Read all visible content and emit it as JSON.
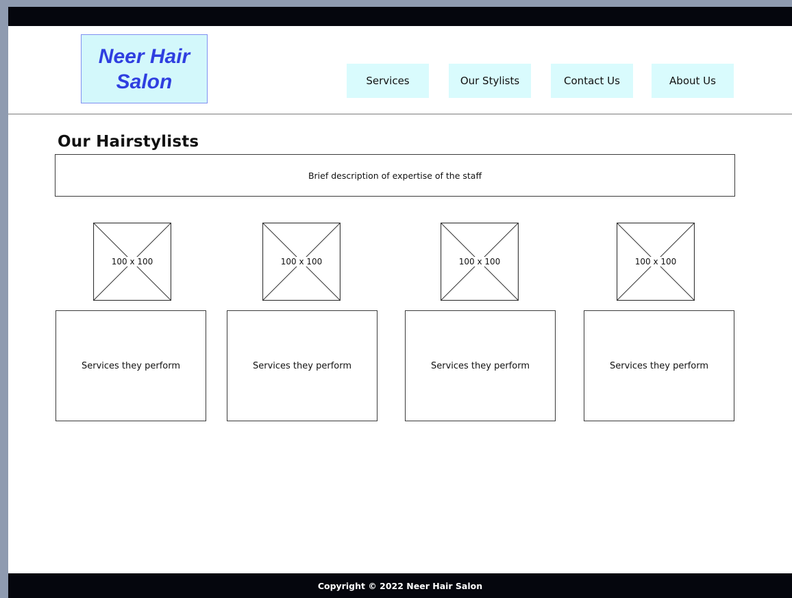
{
  "header": {
    "logo_text": "Neer Hair Salon",
    "nav": [
      {
        "label": "Services"
      },
      {
        "label": "Our Stylists"
      },
      {
        "label": "Contact Us"
      },
      {
        "label": "About Us"
      }
    ]
  },
  "main": {
    "title": "Our Hairstylists",
    "description": "Brief description of expertise of the staff",
    "stylists": [
      {
        "image_label": "100 x 100",
        "services": "Services they perform"
      },
      {
        "image_label": "100 x 100",
        "services": "Services they perform"
      },
      {
        "image_label": "100 x 100",
        "services": "Services they perform"
      },
      {
        "image_label": "100 x 100",
        "services": "Services they perform"
      }
    ]
  },
  "footer": {
    "copyright": "Copyright © 2022 Neer Hair Salon"
  },
  "colors": {
    "logo_bg": "#d3f8fb",
    "logo_text": "#2f3fe0",
    "nav_bg": "#d9fbfd",
    "bars": "#05060d"
  }
}
